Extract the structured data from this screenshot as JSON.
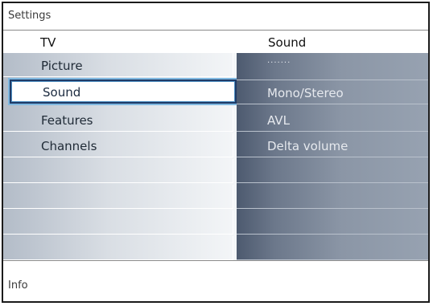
{
  "window": {
    "title": "Settings"
  },
  "header": {
    "left": "TV",
    "right": "Sound"
  },
  "left_menu": [
    {
      "label": "Picture",
      "selected": false
    },
    {
      "label": "Sound",
      "selected": true
    },
    {
      "label": "Features",
      "selected": false
    },
    {
      "label": "Channels",
      "selected": false
    },
    {
      "label": "",
      "selected": false
    },
    {
      "label": "",
      "selected": false
    },
    {
      "label": "",
      "selected": false
    },
    {
      "label": "",
      "selected": false
    }
  ],
  "right_menu": [
    {
      "label": "·······"
    },
    {
      "label": "Mono/Stereo"
    },
    {
      "label": "AVL"
    },
    {
      "label": "Delta volume"
    },
    {
      "label": ""
    },
    {
      "label": ""
    },
    {
      "label": ""
    },
    {
      "label": ""
    }
  ],
  "footer": {
    "info": "Info"
  },
  "colors": {
    "selection_border": "#1f3b67",
    "selection_glow": "#7fb8e0",
    "right_panel": "#6c788b"
  }
}
